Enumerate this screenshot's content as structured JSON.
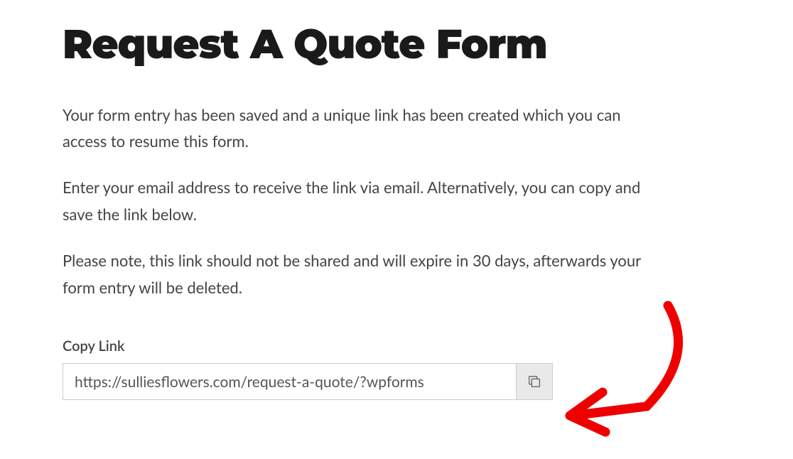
{
  "title": "Request A Quote Form",
  "paragraphs": {
    "saved": "Your form entry has been saved and a unique link has been created which you can access to resume this form.",
    "email": "Enter your email address to receive the link via email. Alternatively, you can copy and save the link below.",
    "expire": "Please note, this link should not be shared and will expire in 30 days, afterwards your form entry will be deleted."
  },
  "copy_link": {
    "label": "Copy Link",
    "value": "https://sulliesflowers.com/request-a-quote/?wpforms"
  }
}
